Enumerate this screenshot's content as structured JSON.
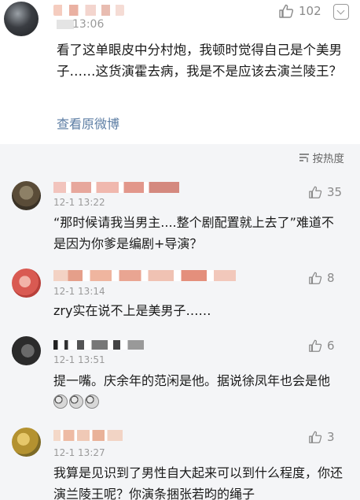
{
  "main_post": {
    "time": "13:06",
    "likes": "102",
    "text": "看了这单眼皮中分村炮，我顿时觉得自己是个美男子……这货演霍去病，我是不是应该去演兰陵王？",
    "view_original": "查看原微博"
  },
  "sort": {
    "label": "按热度",
    "icon": "sort-icon"
  },
  "comments": [
    {
      "time": "12-1 13:22",
      "likes": "35",
      "text": "“那时候请我当男主....整个剧配置就上去了”难道不是因为你爹是编剧+导演？"
    },
    {
      "time": "12-1 13:14",
      "likes": "8",
      "text": "zry实在说不上是美男子……"
    },
    {
      "time": "12-1 13:51",
      "likes": "6",
      "text": "提一嘴。庆余年的范闲是他。据说徐凤年也会是他"
    },
    {
      "time": "12-1 13:27",
      "likes": "3",
      "text": "我算是见识到了男性自大起来可以到什么程度，你还演兰陵王呢？你演条捆张若昀的绳子"
    }
  ],
  "icons": {
    "like": "thumbs-up-icon",
    "menu": "chevron-down-icon",
    "emoji": "crying-emoji-icon"
  }
}
